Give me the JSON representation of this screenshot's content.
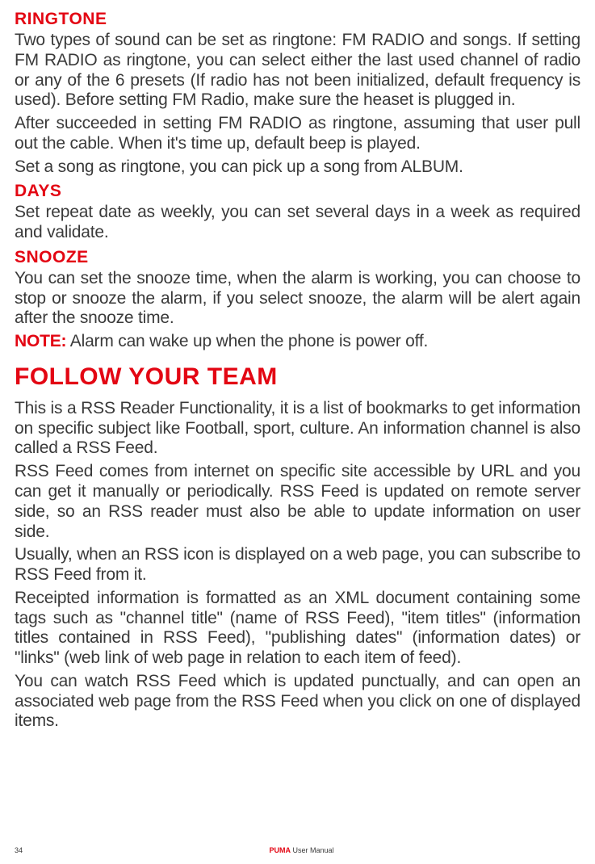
{
  "sections": {
    "ringtone": {
      "heading": "RINGTONE",
      "p1": "Two types of sound can be set as ringtone: FM RADIO and songs. If setting FM RADIO as ringtone, you can select either the last used channel of radio or any of the 6 presets (If radio has not been initialized, default frequency is used). Before setting FM Radio, make sure the heaset is plugged in.",
      "p2": "After succeeded in setting FM RADIO as ringtone, assuming that user pull out the cable. When it's time up, default beep is played.",
      "p3": "Set a song as ringtone, you can pick up a song from ALBUM."
    },
    "days": {
      "heading": "DAYS",
      "p1": "Set repeat date as weekly, you can set several days in a week as required and validate."
    },
    "snooze": {
      "heading": "SNOOZE",
      "p1": "You can set the snooze time, when the alarm is working, you can choose to stop or snooze the alarm, if you select snooze, the alarm will be alert again after the snooze time.",
      "noteLabel": "NOTE:",
      "noteText": " Alarm can wake up when the phone is power off."
    },
    "follow": {
      "heading": "FOLLOW YOUR TEAM",
      "p1": "This is a RSS Reader Functionality, it is a list of bookmarks to get information on specific subject like Football, sport, culture. An information channel is also called a RSS Feed.",
      "p2": "RSS Feed comes from internet on specific site accessible by URL and you can get it manually or periodically. RSS Feed is updated on remote server side, so an RSS reader must also be able to update information on user side.",
      "p3": "Usually, when an RSS icon is displayed on a web page, you can subscribe to RSS Feed from it.",
      "p4": "Receipted information is formatted as an XML document containing some tags such as \"channel title\" (name of RSS Feed), \"item titles\" (information titles contained in RSS Feed), \"publishing dates\" (information dates) or \"links\" (web link of web page in relation to each item of feed).",
      "p5": "You can watch RSS Feed which is updated punctually, and can open an associated web page from the RSS Feed when you click on one of displayed items."
    }
  },
  "footer": {
    "page": "34",
    "brand": "PUMA",
    "suffix": " User Manual"
  }
}
